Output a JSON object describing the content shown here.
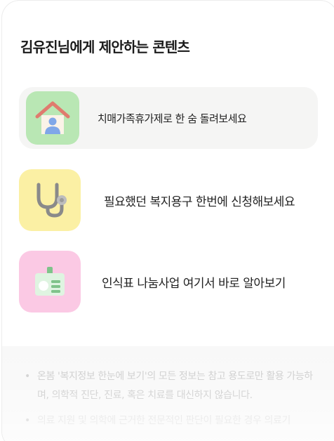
{
  "page": {
    "title": "김유진님에게 제안하는 콘텐츠"
  },
  "contents": [
    {
      "label": "치매가족휴가제로 한 숨 돌려보세요",
      "icon": "house-person-icon",
      "color": "#b9e7b4"
    },
    {
      "label": "필요했던 복지용구 한번에 신청해보세요",
      "icon": "stethoscope-icon",
      "color": "#fbf0a4"
    },
    {
      "label": "인식표 나눔사업 여기서 바로 알아보기",
      "icon": "id-card-icon",
      "color": "#fbc9e4"
    }
  ],
  "notice": {
    "lines": [
      "온봄 '복지정보 한눈에 보기'의 모든 정보는 참고 용도로만 활용 가능하며, 의학적 진단, 진료, 혹은 치료를 대신하지 않습니다.",
      "의료 지원 및 의학에 근거한 전문적인 판단이 필요한 경우 의료기"
    ]
  }
}
